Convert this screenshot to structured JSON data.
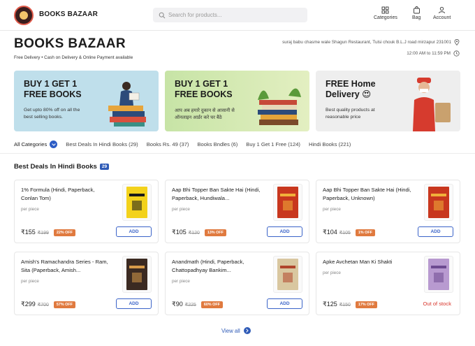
{
  "header": {
    "brand": "BOOKS BAZAAR",
    "search_placeholder": "Search for products...",
    "nav": [
      {
        "label": "Categories",
        "icon": "grid-icon"
      },
      {
        "label": "Bag",
        "icon": "bag-icon"
      },
      {
        "label": "Account",
        "icon": "user-icon"
      }
    ]
  },
  "store": {
    "title": "BOOKS BAZAAR",
    "features": "Free Delivery  •  Cash on Delivery & Online Payment available",
    "address": "suraj babu chasme wale Shagun Restaurant, Tulsi chouk B.L.J road mirzapur 231001",
    "hours": "12:00 AM to 11:59 PM"
  },
  "banners": [
    {
      "title": "BUY 1 GET 1\nFREE BOOKS",
      "subtitle": "Get upto 80% off on all the\nbest selling books."
    },
    {
      "title": "BUY 1 GET 1\nFREE BOOKS",
      "subtitle": "आप अब हमारे दुकान से आसानी से\nऑनलाइन आर्डर करे घर बैठे"
    },
    {
      "title": "FREE Home\nDelivery 😍",
      "subtitle": "Best quality products at\nreasonable price"
    }
  ],
  "tabs": [
    {
      "label": "All Categories"
    },
    {
      "label": "Best Deals In Hindi Books (29)"
    },
    {
      "label": "Books Rs. 49 (37)"
    },
    {
      "label": "Books Bndles (6)"
    },
    {
      "label": "Buy 1 Get 1 Free (124)"
    },
    {
      "label": "Hindi Books (221)"
    }
  ],
  "section": {
    "title": "Best Deals In Hindi Books",
    "count": "29"
  },
  "products": [
    {
      "name": "1% Formula (Hindi, Paperback, Conlan Tom)",
      "per": "per piece",
      "price": "₹155",
      "mrp": "₹199",
      "off": "22% OFF",
      "action": "ADD",
      "cover_color": "#f3d21b",
      "cover_accent": "#1a1a1a"
    },
    {
      "name": "Aap Bhi Topper Ban Sakte Hai (Hindi, Paperback, Hundiwala...",
      "per": "per piece",
      "price": "₹105",
      "mrp": "₹120",
      "off": "13% OFF",
      "action": "ADD",
      "cover_color": "#c8371e",
      "cover_accent": "#f1b03a"
    },
    {
      "name": "Aap Bhi Topper Ban Sakte Hai (Hindi, Paperback, Unknown)",
      "per": "per piece",
      "price": "₹104",
      "mrp": "₹105",
      "off": "1% OFF",
      "action": "ADD",
      "cover_color": "#c8371e",
      "cover_accent": "#f1b03a"
    },
    {
      "name": "Amish's Ramachandra Series - Ram, Sita (Paperback, Amish...",
      "per": "per piece",
      "price": "₹299",
      "mrp": "₹700",
      "off": "57% OFF",
      "action": "ADD",
      "cover_color": "#3b2a22",
      "cover_accent": "#d89b4a"
    },
    {
      "name": "Anandmath (Hindi, Paperback, Chattopadhyay Bankim...",
      "per": "per piece",
      "price": "₹90",
      "mrp": "₹225",
      "off": "60% OFF",
      "action": "ADD",
      "cover_color": "#d9c7a0",
      "cover_accent": "#b0452c"
    },
    {
      "name": "Apke Avchetan Man Ki Shakti",
      "per": "per piece",
      "price": "₹125",
      "mrp": "₹150",
      "off": "17% OFF",
      "action": "Out of stock",
      "cover_color": "#b89ad0",
      "cover_accent": "#6d4a90"
    }
  ],
  "view_all": "View all",
  "colors": {
    "accent": "#2f5bb7",
    "discount": "#e07a3f",
    "out_of_stock": "#d8342a"
  }
}
